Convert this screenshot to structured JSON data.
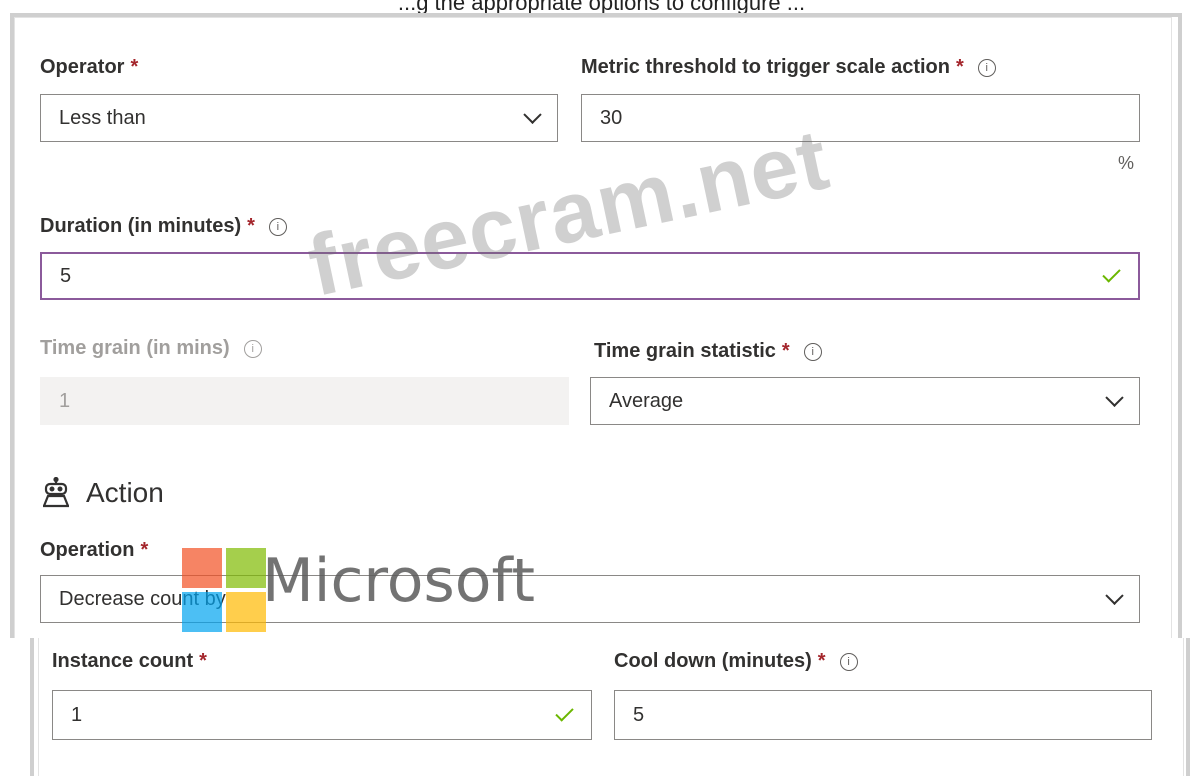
{
  "header_caption": "...g the appropriate options to configure ...",
  "operator": {
    "label": "Operator",
    "value": "Less than"
  },
  "threshold": {
    "label": "Metric threshold to trigger scale action",
    "value": "30",
    "unit": "%"
  },
  "duration": {
    "label": "Duration (in minutes)",
    "value": "5"
  },
  "time_grain": {
    "label": "Time grain (in mins)",
    "value": "1"
  },
  "grain_statistic": {
    "label": "Time grain statistic",
    "value": "Average"
  },
  "action": {
    "title": "Action",
    "icon": "robot-icon"
  },
  "operation": {
    "label": "Operation",
    "value": "Decrease count by"
  },
  "instance_count": {
    "label": "Instance count",
    "value": "1"
  },
  "cool_down": {
    "label": "Cool down (minutes)",
    "value": "5"
  },
  "required_marker": "*",
  "info_glyph": "i",
  "watermark": {
    "text": "freecram.net"
  },
  "ms_logo": {
    "text": "Microsoft",
    "colors": [
      "#f25022",
      "#7fba00",
      "#00a4ef",
      "#ffb900"
    ]
  }
}
